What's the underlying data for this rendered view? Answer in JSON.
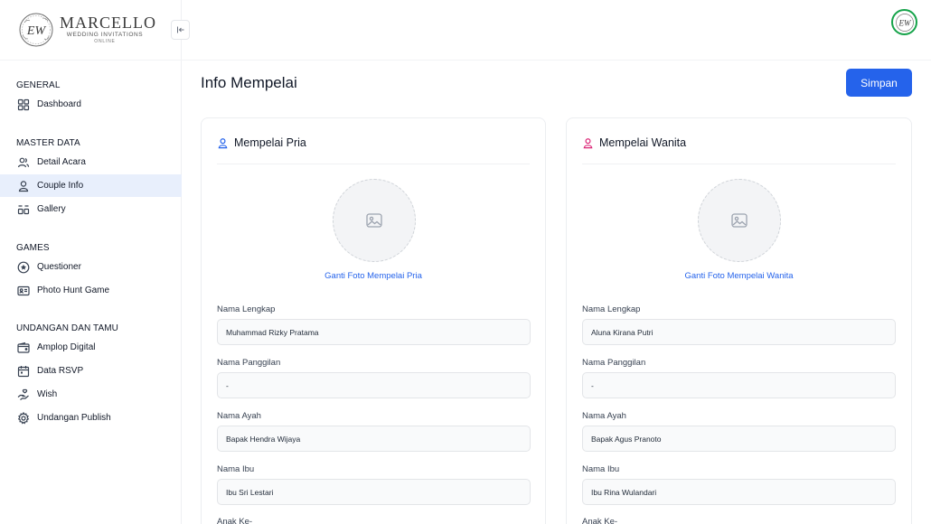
{
  "brand": {
    "monogram": "EW",
    "name": "MARCELLO",
    "tagline": "WEDDING INVITATIONS",
    "sub_tagline": "ONLINE"
  },
  "sidebar": {
    "sections": [
      {
        "heading": "GENERAL",
        "items": [
          {
            "label": "Dashboard",
            "icon": "dashboard-icon"
          }
        ]
      },
      {
        "heading": "MASTER DATA",
        "items": [
          {
            "label": "Detail Acara",
            "icon": "users-icon"
          },
          {
            "label": "Couple Info",
            "icon": "user-icon",
            "active": true
          },
          {
            "label": "Gallery",
            "icon": "gallery-icon"
          }
        ]
      },
      {
        "heading": "GAMES",
        "items": [
          {
            "label": "Questioner",
            "icon": "star-circle-icon"
          },
          {
            "label": "Photo Hunt Game",
            "icon": "id-card-icon"
          }
        ]
      },
      {
        "heading": "UNDANGAN DAN TAMU",
        "items": [
          {
            "label": "Amplop Digital",
            "icon": "wallet-icon"
          },
          {
            "label": "Data RSVP",
            "icon": "calendar-icon"
          },
          {
            "label": "Wish",
            "icon": "hand-heart-icon"
          },
          {
            "label": "Undangan Publish",
            "icon": "gear-icon"
          }
        ]
      }
    ]
  },
  "main": {
    "title": "Info Mempelai",
    "save_label": "Simpan"
  },
  "groom": {
    "title": "Mempelai Pria",
    "photo_link": "Ganti Foto Mempelai Pria",
    "fields": [
      {
        "label": "Nama Lengkap",
        "value": "Muhammad Rizky Pratama"
      },
      {
        "label": "Nama Panggilan",
        "value": "-"
      },
      {
        "label": "Nama Ayah",
        "value": "Bapak Hendra Wijaya"
      },
      {
        "label": "Nama Ibu",
        "value": "Ibu Sri Lestari"
      },
      {
        "label": "Anak Ke-",
        "value": ""
      }
    ]
  },
  "bride": {
    "title": "Mempelai Wanita",
    "photo_link": "Ganti Foto Mempelai Wanita",
    "fields": [
      {
        "label": "Nama Lengkap",
        "value": "Aluna Kirana Putri"
      },
      {
        "label": "Nama Panggilan",
        "value": "-"
      },
      {
        "label": "Nama Ayah",
        "value": "Bapak Agus Pranoto"
      },
      {
        "label": "Nama Ibu",
        "value": "Ibu Rina Wulandari"
      },
      {
        "label": "Anak Ke-",
        "value": ""
      }
    ]
  },
  "colors": {
    "primary": "#2563eb",
    "active_nav_bg": "#e8effc",
    "groom_icon": "#2563eb",
    "bride_icon": "#db2777",
    "avatar_ring": "#16a34a"
  }
}
